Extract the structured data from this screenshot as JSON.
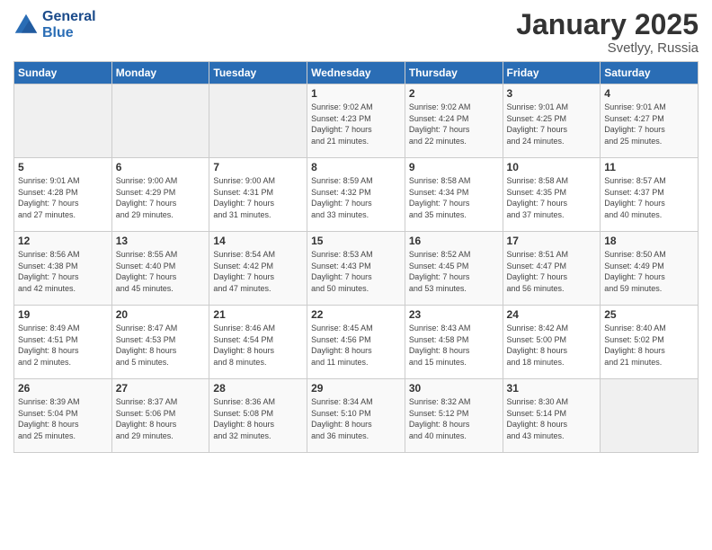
{
  "header": {
    "logo_line1": "General",
    "logo_line2": "Blue",
    "month": "January 2025",
    "location": "Svetlyy, Russia"
  },
  "weekdays": [
    "Sunday",
    "Monday",
    "Tuesday",
    "Wednesday",
    "Thursday",
    "Friday",
    "Saturday"
  ],
  "weeks": [
    [
      {
        "day": "",
        "info": ""
      },
      {
        "day": "",
        "info": ""
      },
      {
        "day": "",
        "info": ""
      },
      {
        "day": "1",
        "info": "Sunrise: 9:02 AM\nSunset: 4:23 PM\nDaylight: 7 hours\nand 21 minutes."
      },
      {
        "day": "2",
        "info": "Sunrise: 9:02 AM\nSunset: 4:24 PM\nDaylight: 7 hours\nand 22 minutes."
      },
      {
        "day": "3",
        "info": "Sunrise: 9:01 AM\nSunset: 4:25 PM\nDaylight: 7 hours\nand 24 minutes."
      },
      {
        "day": "4",
        "info": "Sunrise: 9:01 AM\nSunset: 4:27 PM\nDaylight: 7 hours\nand 25 minutes."
      }
    ],
    [
      {
        "day": "5",
        "info": "Sunrise: 9:01 AM\nSunset: 4:28 PM\nDaylight: 7 hours\nand 27 minutes."
      },
      {
        "day": "6",
        "info": "Sunrise: 9:00 AM\nSunset: 4:29 PM\nDaylight: 7 hours\nand 29 minutes."
      },
      {
        "day": "7",
        "info": "Sunrise: 9:00 AM\nSunset: 4:31 PM\nDaylight: 7 hours\nand 31 minutes."
      },
      {
        "day": "8",
        "info": "Sunrise: 8:59 AM\nSunset: 4:32 PM\nDaylight: 7 hours\nand 33 minutes."
      },
      {
        "day": "9",
        "info": "Sunrise: 8:58 AM\nSunset: 4:34 PM\nDaylight: 7 hours\nand 35 minutes."
      },
      {
        "day": "10",
        "info": "Sunrise: 8:58 AM\nSunset: 4:35 PM\nDaylight: 7 hours\nand 37 minutes."
      },
      {
        "day": "11",
        "info": "Sunrise: 8:57 AM\nSunset: 4:37 PM\nDaylight: 7 hours\nand 40 minutes."
      }
    ],
    [
      {
        "day": "12",
        "info": "Sunrise: 8:56 AM\nSunset: 4:38 PM\nDaylight: 7 hours\nand 42 minutes."
      },
      {
        "day": "13",
        "info": "Sunrise: 8:55 AM\nSunset: 4:40 PM\nDaylight: 7 hours\nand 45 minutes."
      },
      {
        "day": "14",
        "info": "Sunrise: 8:54 AM\nSunset: 4:42 PM\nDaylight: 7 hours\nand 47 minutes."
      },
      {
        "day": "15",
        "info": "Sunrise: 8:53 AM\nSunset: 4:43 PM\nDaylight: 7 hours\nand 50 minutes."
      },
      {
        "day": "16",
        "info": "Sunrise: 8:52 AM\nSunset: 4:45 PM\nDaylight: 7 hours\nand 53 minutes."
      },
      {
        "day": "17",
        "info": "Sunrise: 8:51 AM\nSunset: 4:47 PM\nDaylight: 7 hours\nand 56 minutes."
      },
      {
        "day": "18",
        "info": "Sunrise: 8:50 AM\nSunset: 4:49 PM\nDaylight: 7 hours\nand 59 minutes."
      }
    ],
    [
      {
        "day": "19",
        "info": "Sunrise: 8:49 AM\nSunset: 4:51 PM\nDaylight: 8 hours\nand 2 minutes."
      },
      {
        "day": "20",
        "info": "Sunrise: 8:47 AM\nSunset: 4:53 PM\nDaylight: 8 hours\nand 5 minutes."
      },
      {
        "day": "21",
        "info": "Sunrise: 8:46 AM\nSunset: 4:54 PM\nDaylight: 8 hours\nand 8 minutes."
      },
      {
        "day": "22",
        "info": "Sunrise: 8:45 AM\nSunset: 4:56 PM\nDaylight: 8 hours\nand 11 minutes."
      },
      {
        "day": "23",
        "info": "Sunrise: 8:43 AM\nSunset: 4:58 PM\nDaylight: 8 hours\nand 15 minutes."
      },
      {
        "day": "24",
        "info": "Sunrise: 8:42 AM\nSunset: 5:00 PM\nDaylight: 8 hours\nand 18 minutes."
      },
      {
        "day": "25",
        "info": "Sunrise: 8:40 AM\nSunset: 5:02 PM\nDaylight: 8 hours\nand 21 minutes."
      }
    ],
    [
      {
        "day": "26",
        "info": "Sunrise: 8:39 AM\nSunset: 5:04 PM\nDaylight: 8 hours\nand 25 minutes."
      },
      {
        "day": "27",
        "info": "Sunrise: 8:37 AM\nSunset: 5:06 PM\nDaylight: 8 hours\nand 29 minutes."
      },
      {
        "day": "28",
        "info": "Sunrise: 8:36 AM\nSunset: 5:08 PM\nDaylight: 8 hours\nand 32 minutes."
      },
      {
        "day": "29",
        "info": "Sunrise: 8:34 AM\nSunset: 5:10 PM\nDaylight: 8 hours\nand 36 minutes."
      },
      {
        "day": "30",
        "info": "Sunrise: 8:32 AM\nSunset: 5:12 PM\nDaylight: 8 hours\nand 40 minutes."
      },
      {
        "day": "31",
        "info": "Sunrise: 8:30 AM\nSunset: 5:14 PM\nDaylight: 8 hours\nand 43 minutes."
      },
      {
        "day": "",
        "info": ""
      }
    ]
  ]
}
